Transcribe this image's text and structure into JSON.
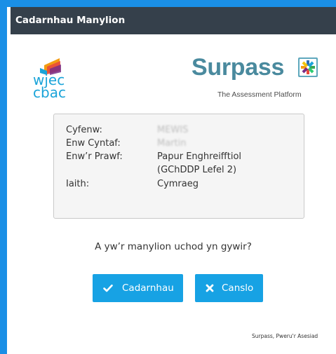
{
  "dialog": {
    "title": "Cadarnhau Manylion"
  },
  "logos": {
    "wjec_top": "wjec",
    "wjec_bottom": "cbac",
    "surpass_name": "Surpass",
    "surpass_tagline": "The Assessment Platform",
    "wjec_colors": [
      "#7a2d85",
      "#e94b3c",
      "#f39c12",
      "#1ba4d9"
    ]
  },
  "details": {
    "rows": [
      {
        "label": "Cyfenw:",
        "value": "MEWIS",
        "redacted": true
      },
      {
        "label": "Enw Cyntaf:",
        "value": "Martin",
        "redacted": true
      },
      {
        "label": "Enw’r Prawf:",
        "value": "Papur Enghreifftiol",
        "value_line2": "(GChDDP Lefel 2)"
      },
      {
        "label": "Iaith:",
        "value": "Cymraeg"
      }
    ]
  },
  "question": "A yw’r manylion uchod yn gywir?",
  "buttons": {
    "confirm_label": "Cadarnhau",
    "confirm_icon": "check-icon",
    "cancel_label": "Canslo",
    "cancel_icon": "close-icon"
  },
  "footer": "Surpass, Pweru'r Asesiad",
  "colors": {
    "header_bg": "#35404b",
    "button_bg": "#17a2e4",
    "frame": "#1a8fe6",
    "surpass_teal": "#4a8a9e"
  }
}
